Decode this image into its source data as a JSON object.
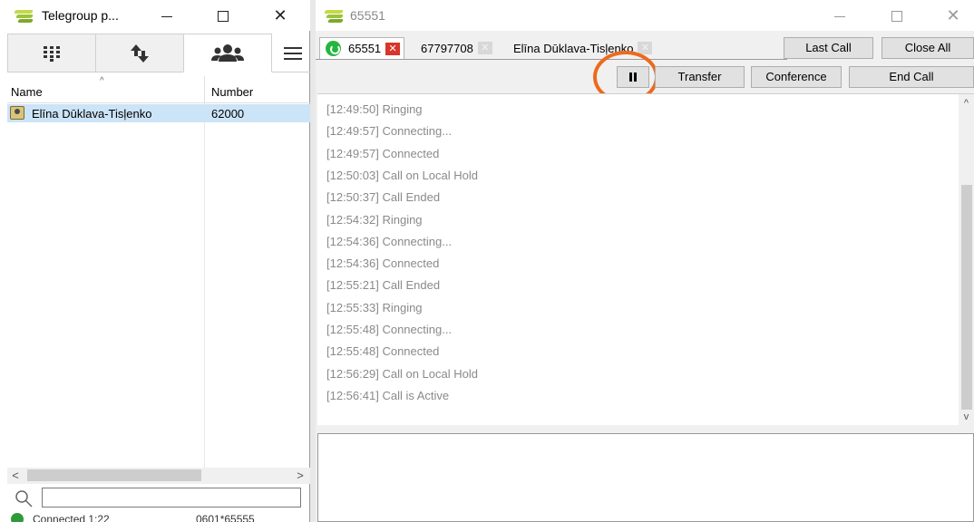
{
  "left_window": {
    "title": "Telegroup p...",
    "controls": {
      "minimize": "—",
      "maximize": "",
      "close": "✕"
    },
    "tabs": [
      {
        "name": "dialpad",
        "icon": "dialpad-icon"
      },
      {
        "name": "transfer",
        "icon": "arrows-updown-icon"
      },
      {
        "name": "contacts",
        "icon": "people-icon"
      }
    ],
    "columns": {
      "name": "Name",
      "number": "Number"
    },
    "contacts": [
      {
        "name": "Elīna Dūklava-Tisļenko",
        "number": "62000"
      }
    ],
    "search": {
      "value": "",
      "placeholder": ""
    },
    "status_text": "Connected 1:22",
    "status_number": "0601*65555"
  },
  "right_window": {
    "title": "65551",
    "controls": {
      "minimize": "—",
      "maximize": "",
      "close": "✕"
    },
    "call_tabs": [
      {
        "label": "65551",
        "active": true
      },
      {
        "label": "67797708",
        "active": false
      },
      {
        "label": "Elīna Dūklava-Tisļenko",
        "active": false
      }
    ],
    "buttons": {
      "last_call": "Last Call",
      "close_all": "Close All",
      "transfer": "Transfer",
      "conference": "Conference",
      "end_call": "End Call"
    },
    "log": [
      {
        "time": "[12:49:50]",
        "event": "Ringing"
      },
      {
        "time": "[12:49:57]",
        "event": "Connecting..."
      },
      {
        "time": "[12:49:57]",
        "event": "Connected"
      },
      {
        "time": "[12:50:03]",
        "event": "Call on Local Hold"
      },
      {
        "time": "[12:50:37]",
        "event": "Call Ended"
      },
      {
        "time": "[12:54:32]",
        "event": "Ringing"
      },
      {
        "time": "[12:54:36]",
        "event": "Connecting..."
      },
      {
        "time": "[12:54:36]",
        "event": "Connected"
      },
      {
        "time": "[12:55:21]",
        "event": "Call Ended"
      },
      {
        "time": "[12:55:33]",
        "event": "Ringing"
      },
      {
        "time": "[12:55:48]",
        "event": "Connecting..."
      },
      {
        "time": "[12:55:48]",
        "event": "Connected"
      },
      {
        "time": "[12:56:29]",
        "event": "Call on Local Hold"
      },
      {
        "time": "[12:56:41]",
        "event": "Call is Active"
      }
    ]
  },
  "colors": {
    "selection": "#cce4f7",
    "accent_green": "#25b640",
    "close_red": "#d9352a",
    "highlight_orange": "#ec6a1d"
  }
}
